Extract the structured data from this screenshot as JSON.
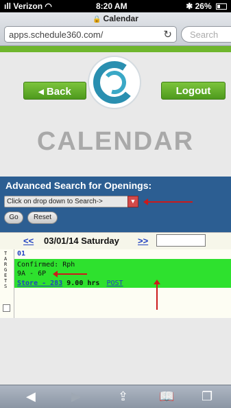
{
  "status_bar": {
    "carrier": "Verizon",
    "signal": "ıll",
    "wifi": "◠",
    "time": "8:20 AM",
    "bluetooth": "✱",
    "battery": "26%"
  },
  "safari": {
    "page_title": "Calendar",
    "url": "apps.schedule360.com/",
    "search_placeholder": "Search"
  },
  "header": {
    "back_label": "Back",
    "logout_label": "Logout",
    "heading": "CALENDAR"
  },
  "search": {
    "title": "Advanced Search for Openings:",
    "dropdown_value": "Click on drop down to Search->",
    "go_label": "Go",
    "reset_label": "Reset"
  },
  "date_nav": {
    "prev": "<<",
    "date": "03/01/14 Saturday",
    "next": ">>"
  },
  "targets_label": "TARGETS",
  "day": {
    "number": "01",
    "status": "Confirmed: Rph",
    "time": "9A - 6P",
    "store_link": "Store - 283",
    "hours": "9.00 hrs",
    "post_link": "POST"
  },
  "toolbar_icons": [
    "back-icon",
    "forward-icon",
    "share-icon",
    "bookmarks-icon",
    "tabs-icon"
  ],
  "colors": {
    "accent_green": "#6fb62d",
    "panel_blue": "#2c5e92",
    "shift_green": "#2ee12e",
    "annotation_red": "#cc1a1a"
  }
}
